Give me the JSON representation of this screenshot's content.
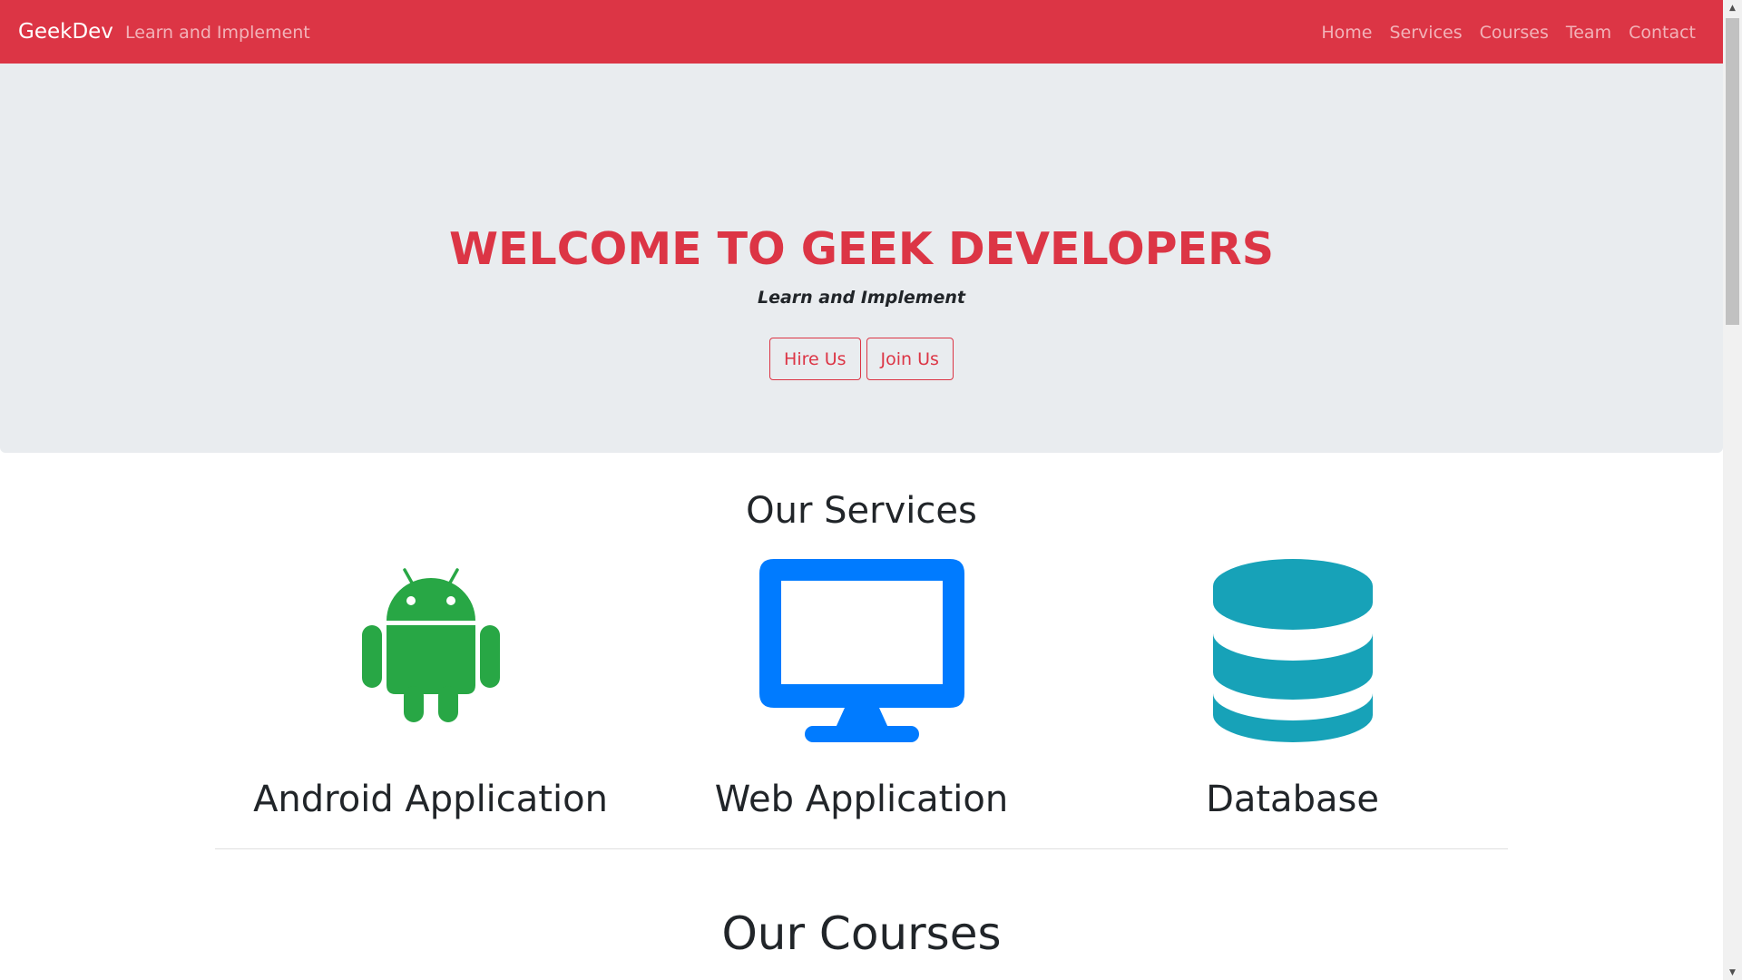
{
  "navbar": {
    "brand": "GeekDev",
    "tagline": "Learn and Implement",
    "links": [
      "Home",
      "Services",
      "Courses",
      "Team",
      "Contact"
    ],
    "background_color": "#dc3545"
  },
  "hero": {
    "title": "WELCOME TO GEEK DEVELOPERS",
    "subtitle": "Learn and Implement",
    "buttons": [
      "Hire Us",
      "Join Us"
    ],
    "background_color": "#e9ecef",
    "accent_color": "#dc3545"
  },
  "services": {
    "title": "Our Services",
    "items": [
      {
        "label": "Android Application",
        "icon": "android-icon",
        "color": "#28a745"
      },
      {
        "label": "Web Application",
        "icon": "desktop-monitor-icon",
        "color": "#007bff"
      },
      {
        "label": "Database",
        "icon": "database-icon",
        "color": "#17a2b8"
      }
    ]
  },
  "courses": {
    "title": "Our Courses"
  }
}
